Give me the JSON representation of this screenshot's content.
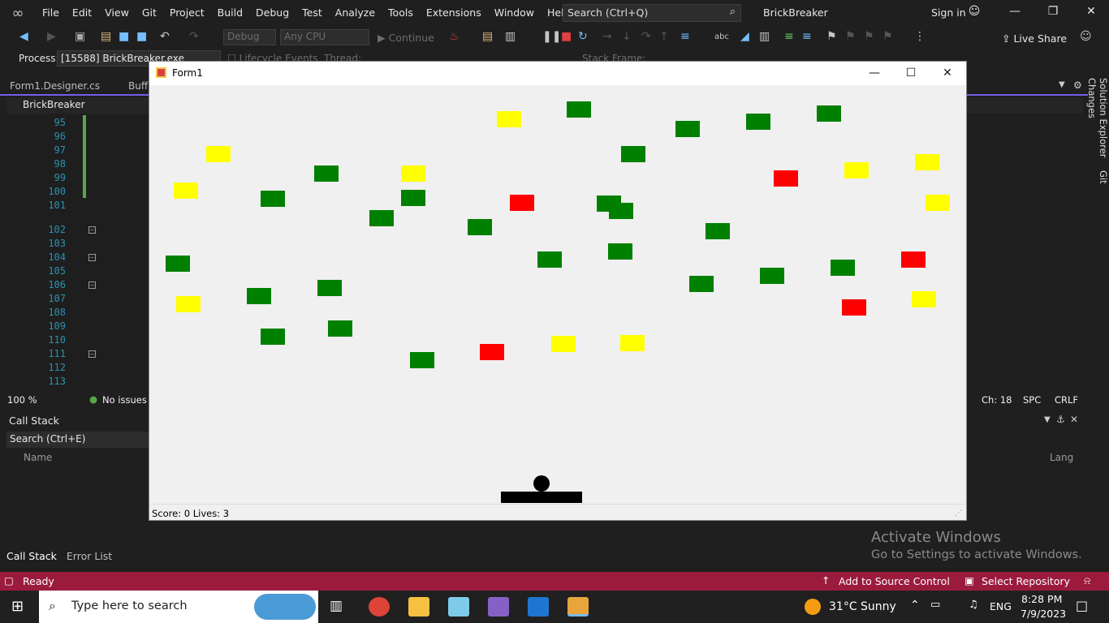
{
  "menubar": {
    "items": [
      "File",
      "Edit",
      "View",
      "Git",
      "Project",
      "Build",
      "Debug",
      "Test",
      "Analyze",
      "Tools",
      "Extensions",
      "Window",
      "Help"
    ],
    "search_placeholder": "Search (Ctrl+Q)",
    "solution_name": "BrickBreaker",
    "sign_in": "Sign in"
  },
  "toolbar": {
    "config": "Debug",
    "platform": "Any CPU",
    "continue": "Continue",
    "live_share": "Live Share"
  },
  "procbar": {
    "label": "Process:",
    "process": "[15588] BrickBreaker.exe",
    "lifecycle": "Lifecycle Events",
    "thread": "Thread:",
    "stack_frame": "Stack Frame:"
  },
  "editor": {
    "tabs": [
      "Form1.Designer.cs",
      "Buff"
    ],
    "nav_project": "BrickBreaker",
    "lines": [
      "95",
      "96",
      "97",
      "98",
      "99",
      "100",
      "101",
      "102",
      "103",
      "104",
      "105",
      "106",
      "107",
      "108",
      "109",
      "110",
      "111",
      "112",
      "113"
    ],
    "zoom": "100 %",
    "issues": "No issues f",
    "ch": "Ch: 18",
    "spc": "SPC",
    "crlf": "CRLF"
  },
  "right_rail": [
    "Solution Explorer",
    "Git Changes"
  ],
  "callstack": {
    "title": "Call Stack",
    "search": "Search (Ctrl+E)",
    "col_name": "Name",
    "col_lang": "Lang",
    "bottom_tabs": [
      "Call Stack",
      "Error List"
    ]
  },
  "statusbar": {
    "ready": "Ready",
    "source_control": "Add to Source Control",
    "repository": "Select Repository"
  },
  "watermark": {
    "line1": "Activate Windows",
    "line2": "Go to Settings to activate Windows."
  },
  "taskbar": {
    "search": "Type here to search",
    "weather": "31°C  Sunny",
    "lang": "ENG",
    "time": "8:28 PM",
    "date": "7/9/2023"
  },
  "form": {
    "title": "Form1",
    "score_text": "Score: 0  Lives: 3",
    "colors": {
      "green": "#008000",
      "yellow": "#ffff00",
      "red": "#ff0000"
    },
    "bricks": [
      {
        "color": "yellow"
      },
      {
        "color": "green"
      },
      {
        "color": "green"
      },
      {
        "color": "green"
      },
      {
        "color": "green"
      },
      {
        "color": "yellow"
      },
      {
        "color": "green"
      },
      {
        "color": "green"
      },
      {
        "color": "red"
      },
      {
        "color": "yellow"
      },
      {
        "color": "yellow"
      },
      {
        "color": "green"
      },
      {
        "color": "green"
      },
      {
        "color": "red"
      },
      {
        "color": "yellow"
      },
      {
        "color": "yellow"
      },
      {
        "color": "green"
      },
      {
        "color": "green"
      },
      {
        "color": "green"
      },
      {
        "color": "green"
      },
      {
        "color": "yellow"
      },
      {
        "color": "green"
      },
      {
        "color": "green"
      },
      {
        "color": "green"
      },
      {
        "color": "green"
      },
      {
        "color": "green"
      },
      {
        "color": "green"
      },
      {
        "color": "red"
      },
      {
        "color": "yellow"
      },
      {
        "color": "green"
      },
      {
        "color": "green"
      },
      {
        "color": "green"
      },
      {
        "color": "red"
      },
      {
        "color": "yellow"
      },
      {
        "color": "yellow"
      },
      {
        "color": "green"
      },
      {
        "color": "green"
      },
      {
        "color": "red"
      },
      {
        "color": "yellow"
      },
      {
        "color": "green"
      }
    ]
  }
}
